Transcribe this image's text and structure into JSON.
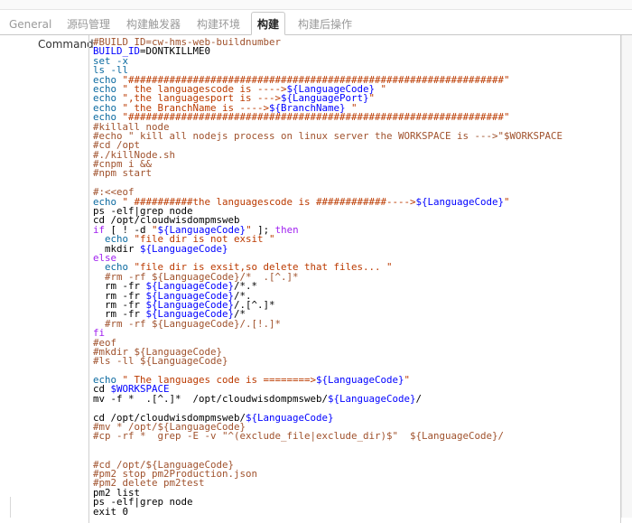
{
  "tabs": [
    {
      "label": "General"
    },
    {
      "label": "源码管理"
    },
    {
      "label": "构建触发器"
    },
    {
      "label": "构建环境"
    },
    {
      "label": "构建"
    },
    {
      "label": "构建后操作"
    }
  ],
  "field_label": "Command",
  "colors": {
    "comment": "#a0522d",
    "keyword": "#a020f0",
    "variable": "#0000ff",
    "string": "#bb3a00",
    "plain": "#000000",
    "builtin": "#0b6aa0"
  },
  "code_lines": [
    [
      {
        "t": "#BUILD_ID=cw-hms-web-buildnumber",
        "c": "comment"
      }
    ],
    [
      {
        "t": "BUILD_ID",
        "c": "variable"
      },
      {
        "t": "=DONTKILLME0",
        "c": "plain"
      }
    ],
    [
      {
        "t": "set -x",
        "c": "builtin"
      }
    ],
    [
      {
        "t": "ls -ll",
        "c": "builtin"
      }
    ],
    [
      {
        "t": "echo ",
        "c": "builtin"
      },
      {
        "t": "\"################################################################\"",
        "c": "string"
      }
    ],
    [
      {
        "t": "echo ",
        "c": "builtin"
      },
      {
        "t": "\" the languagescode is ---->",
        "c": "string"
      },
      {
        "t": "${LanguageCode}",
        "c": "variable"
      },
      {
        "t": " \"",
        "c": "string"
      }
    ],
    [
      {
        "t": "echo ",
        "c": "builtin"
      },
      {
        "t": "\",the languagesport is --->",
        "c": "string"
      },
      {
        "t": "${LanguagePort}",
        "c": "variable"
      },
      {
        "t": "\"",
        "c": "string"
      }
    ],
    [
      {
        "t": "echo ",
        "c": "builtin"
      },
      {
        "t": "\" the BranchName is ---->",
        "c": "string"
      },
      {
        "t": "${BranchName}",
        "c": "variable"
      },
      {
        "t": " \"",
        "c": "string"
      }
    ],
    [
      {
        "t": "echo ",
        "c": "builtin"
      },
      {
        "t": "\"################################################################\"",
        "c": "string"
      }
    ],
    [
      {
        "t": "#killall node",
        "c": "comment"
      }
    ],
    [
      {
        "t": "#echo \" kill all nodejs process on linux server the WORKSPACE is --->\"$WORKSPACE",
        "c": "comment"
      }
    ],
    [
      {
        "t": "#cd /opt",
        "c": "comment"
      }
    ],
    [
      {
        "t": "#./killNode.sh",
        "c": "comment"
      }
    ],
    [
      {
        "t": "#cnpm i &&",
        "c": "comment"
      }
    ],
    [
      {
        "t": "#npm start",
        "c": "comment"
      }
    ],
    [
      {
        "t": "",
        "c": "plain"
      }
    ],
    [
      {
        "t": "#:<<eof",
        "c": "comment"
      }
    ],
    [
      {
        "t": "echo ",
        "c": "builtin"
      },
      {
        "t": "\" ##########the languagescode is ############---->",
        "c": "string"
      },
      {
        "t": "${LanguageCode}",
        "c": "variable"
      },
      {
        "t": "\"",
        "c": "string"
      }
    ],
    [
      {
        "t": "ps -elf|grep node",
        "c": "plain"
      }
    ],
    [
      {
        "t": "cd /opt/cloudwisdompmsweb",
        "c": "plain"
      }
    ],
    [
      {
        "t": "if",
        "c": "keyword"
      },
      {
        "t": " [ ! -d ",
        "c": "plain"
      },
      {
        "t": "\"",
        "c": "string"
      },
      {
        "t": "${LanguageCode}",
        "c": "variable"
      },
      {
        "t": "\"",
        "c": "string"
      },
      {
        "t": " ]; ",
        "c": "plain"
      },
      {
        "t": "then",
        "c": "keyword"
      }
    ],
    [
      {
        "t": "  echo ",
        "c": "builtin"
      },
      {
        "t": "\"file dir is not exsit \"",
        "c": "string"
      }
    ],
    [
      {
        "t": "  mkdir ",
        "c": "plain"
      },
      {
        "t": "${LanguageCode}",
        "c": "variable"
      }
    ],
    [
      {
        "t": "else",
        "c": "keyword"
      }
    ],
    [
      {
        "t": "  echo ",
        "c": "builtin"
      },
      {
        "t": "\"file dir is exsit,so delete that files... \"",
        "c": "string"
      }
    ],
    [
      {
        "t": "  #rm -rf ${LanguageCode}/*  .[^.]*",
        "c": "comment"
      }
    ],
    [
      {
        "t": "  rm -fr ",
        "c": "plain"
      },
      {
        "t": "${LanguageCode}",
        "c": "variable"
      },
      {
        "t": "/*.*",
        "c": "plain"
      }
    ],
    [
      {
        "t": "  rm -fr ",
        "c": "plain"
      },
      {
        "t": "${LanguageCode}",
        "c": "variable"
      },
      {
        "t": "/*.",
        "c": "plain"
      }
    ],
    [
      {
        "t": "  rm -fr ",
        "c": "plain"
      },
      {
        "t": "${LanguageCode}",
        "c": "variable"
      },
      {
        "t": "/.[^.]*",
        "c": "plain"
      }
    ],
    [
      {
        "t": "  rm -fr ",
        "c": "plain"
      },
      {
        "t": "${LanguageCode}",
        "c": "variable"
      },
      {
        "t": "/*",
        "c": "plain"
      }
    ],
    [
      {
        "t": "  #rm -rf ${LanguageCode}/.[!.]*",
        "c": "comment"
      }
    ],
    [
      {
        "t": "fi",
        "c": "keyword"
      }
    ],
    [
      {
        "t": "#eof",
        "c": "comment"
      }
    ],
    [
      {
        "t": "#mkdir ${LanguageCode}",
        "c": "comment"
      }
    ],
    [
      {
        "t": "#ls -ll ${LanguageCode}",
        "c": "comment"
      }
    ],
    [
      {
        "t": "",
        "c": "plain"
      }
    ],
    [
      {
        "t": "echo ",
        "c": "builtin"
      },
      {
        "t": "\" The languages code is ========>",
        "c": "string"
      },
      {
        "t": "${LanguageCode}",
        "c": "variable"
      },
      {
        "t": "\"",
        "c": "string"
      }
    ],
    [
      {
        "t": "cd ",
        "c": "plain"
      },
      {
        "t": "$WORKSPACE",
        "c": "variable"
      }
    ],
    [
      {
        "t": "mv -f *  .[^.]*  /opt/cloudwisdompmsweb/",
        "c": "plain"
      },
      {
        "t": "${LanguageCode}",
        "c": "variable"
      },
      {
        "t": "/",
        "c": "plain"
      }
    ],
    [
      {
        "t": "",
        "c": "plain"
      }
    ],
    [
      {
        "t": "cd /opt/cloudwisdompmsweb/",
        "c": "plain"
      },
      {
        "t": "${LanguageCode}",
        "c": "variable"
      }
    ],
    [
      {
        "t": "#mv * /opt/${LanguageCode}",
        "c": "comment"
      }
    ],
    [
      {
        "t": "#cp -rf *  grep -E -v \"^(exclude_file|exclude_dir)$\"  ${LanguageCode}/",
        "c": "comment"
      }
    ],
    [
      {
        "t": "",
        "c": "plain"
      }
    ],
    [
      {
        "t": "",
        "c": "plain"
      }
    ],
    [
      {
        "t": "#cd /opt/${LanguageCode}",
        "c": "comment"
      }
    ],
    [
      {
        "t": "#pm2 stop pm2Production.json",
        "c": "comment"
      }
    ],
    [
      {
        "t": "#pm2 delete pm2test",
        "c": "comment"
      }
    ],
    [
      {
        "t": "pm2 list",
        "c": "plain"
      }
    ],
    [
      {
        "t": "ps -elf|grep node",
        "c": "plain"
      }
    ],
    [
      {
        "t": "exit 0",
        "c": "plain"
      }
    ]
  ]
}
